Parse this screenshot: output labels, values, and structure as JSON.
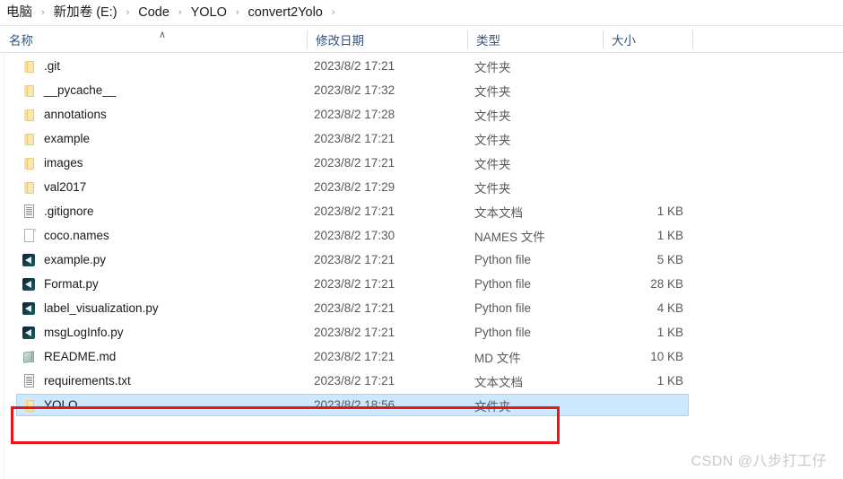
{
  "breadcrumb": {
    "separator": "›",
    "items": [
      {
        "label": "电脑"
      },
      {
        "label": "新加卷 (E:)"
      },
      {
        "label": "Code"
      },
      {
        "label": "YOLO"
      },
      {
        "label": "convert2Yolo"
      }
    ]
  },
  "columns": {
    "name": "名称",
    "date_modified": "修改日期",
    "type": "类型",
    "size": "大小",
    "sort_caret": "∧"
  },
  "rows": [
    {
      "name": ".git",
      "date": "2023/8/2 17:21",
      "type": "文件夹",
      "size": "",
      "icon": "folder-icon",
      "selected": false
    },
    {
      "name": "__pycache__",
      "date": "2023/8/2 17:32",
      "type": "文件夹",
      "size": "",
      "icon": "folder-icon",
      "selected": false
    },
    {
      "name": "annotations",
      "date": "2023/8/2 17:28",
      "type": "文件夹",
      "size": "",
      "icon": "folder-icon",
      "selected": false
    },
    {
      "name": "example",
      "date": "2023/8/2 17:21",
      "type": "文件夹",
      "size": "",
      "icon": "folder-icon",
      "selected": false
    },
    {
      "name": "images",
      "date": "2023/8/2 17:21",
      "type": "文件夹",
      "size": "",
      "icon": "folder-icon",
      "selected": false
    },
    {
      "name": "val2017",
      "date": "2023/8/2 17:29",
      "type": "文件夹",
      "size": "",
      "icon": "folder-icon",
      "selected": false
    },
    {
      "name": ".gitignore",
      "date": "2023/8/2 17:21",
      "type": "文本文档",
      "size": "1 KB",
      "icon": "text-document-icon",
      "selected": false
    },
    {
      "name": "coco.names",
      "date": "2023/8/2 17:30",
      "type": "NAMES 文件",
      "size": "1 KB",
      "icon": "blank-page-icon",
      "selected": false
    },
    {
      "name": "example.py",
      "date": "2023/8/2 17:21",
      "type": "Python file",
      "size": "5 KB",
      "icon": "python-file-icon",
      "selected": false
    },
    {
      "name": "Format.py",
      "date": "2023/8/2 17:21",
      "type": "Python file",
      "size": "28 KB",
      "icon": "python-file-icon",
      "selected": false
    },
    {
      "name": "label_visualization.py",
      "date": "2023/8/2 17:21",
      "type": "Python file",
      "size": "4 KB",
      "icon": "python-file-icon",
      "selected": false
    },
    {
      "name": "msgLogInfo.py",
      "date": "2023/8/2 17:21",
      "type": "Python file",
      "size": "1 KB",
      "icon": "python-file-icon",
      "selected": false
    },
    {
      "name": "README.md",
      "date": "2023/8/2 17:21",
      "type": "MD 文件",
      "size": "10 KB",
      "icon": "markdown-file-icon",
      "selected": false
    },
    {
      "name": "requirements.txt",
      "date": "2023/8/2 17:21",
      "type": "文本文档",
      "size": "1 KB",
      "icon": "text-document-icon",
      "selected": false
    },
    {
      "name": "YOLO",
      "date": "2023/8/2 18:56",
      "type": "文件夹",
      "size": "",
      "icon": "folder-icon",
      "selected": true
    }
  ],
  "annotation": {
    "color": "#e8161b"
  },
  "watermark": {
    "text": "CSDN @八步打工仔"
  },
  "colors": {
    "selection_fill": "#cce8ff",
    "selection_border": "#a8d4f2",
    "header_text": "#36537a",
    "annotation_red": "#e8161b"
  }
}
